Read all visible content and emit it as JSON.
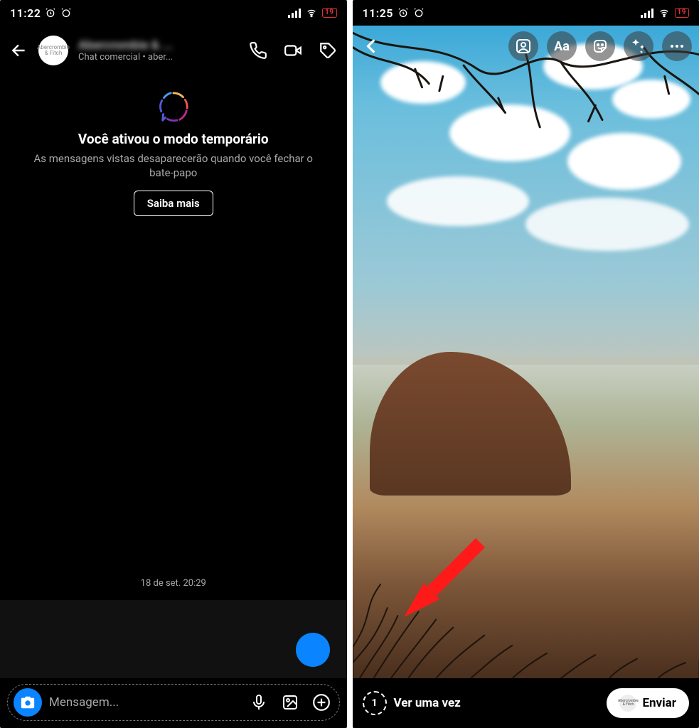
{
  "left": {
    "status": {
      "time": "11:22",
      "battery": "19"
    },
    "header": {
      "name": "Abercrombie & ...",
      "subtitle": "Chat comercial • aber...",
      "avatar_text": "Abercrombie & Fitch"
    },
    "vanish": {
      "title": "Você ativou o modo temporário",
      "desc": "As mensagens vistas desaparecerão quando você fechar o bate-papo",
      "learn_more": "Saiba mais"
    },
    "timestamp": "18 de set. 20:29",
    "input": {
      "placeholder": "Mensagem..."
    }
  },
  "right": {
    "status": {
      "time": "11:25",
      "battery": "19"
    },
    "icons": {
      "text_label": "Aa"
    },
    "view_once": {
      "number": "1",
      "label": "Ver uma vez"
    },
    "send": {
      "label": "Enviar",
      "avatar_text": "Abercrombie & Fitch"
    }
  }
}
